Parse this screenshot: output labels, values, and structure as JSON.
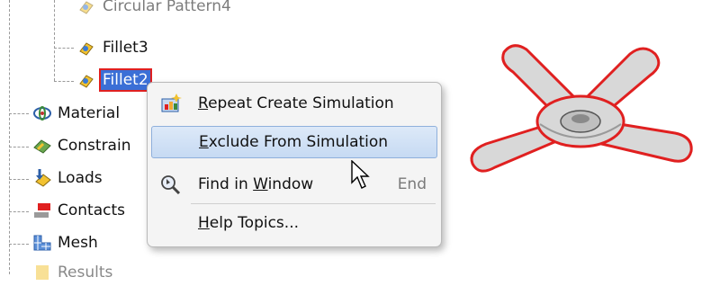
{
  "tree": {
    "items": [
      {
        "label": "Circular Pattern4",
        "icon": "feature-icon"
      },
      {
        "label": "Fillet3",
        "icon": "feature-icon"
      },
      {
        "label": "Fillet2",
        "icon": "feature-icon",
        "selected": true
      },
      {
        "label": "Material",
        "icon": "material-icon"
      },
      {
        "label": "Constrain",
        "icon": "constraints-icon"
      },
      {
        "label": "Loads",
        "icon": "loads-icon"
      },
      {
        "label": "Contacts",
        "icon": "contacts-icon"
      },
      {
        "label": "Mesh",
        "icon": "mesh-icon"
      },
      {
        "label": "Results",
        "icon": "results-icon"
      }
    ]
  },
  "context_menu": {
    "items": [
      {
        "label": "Repeat Create Simulation",
        "accel": "R",
        "rest": "epeat Create Simulation",
        "icon": "simulation-icon"
      },
      {
        "label": "Exclude From Simulation",
        "accel": "E",
        "rest": "xclude From Simulation",
        "highlighted": true
      },
      {
        "label": "Find in Window",
        "pre": "Find in ",
        "accel": "W",
        "rest": "indow",
        "shortcut": "End",
        "icon": "find-icon"
      },
      {
        "label": "Help Topics...",
        "accel": "H",
        "rest": "elp Topics...",
        "icon": ""
      }
    ]
  },
  "colors": {
    "selection": "#3b6fd6",
    "selection_outline": "#e02020",
    "part_outline": "#e02020"
  }
}
